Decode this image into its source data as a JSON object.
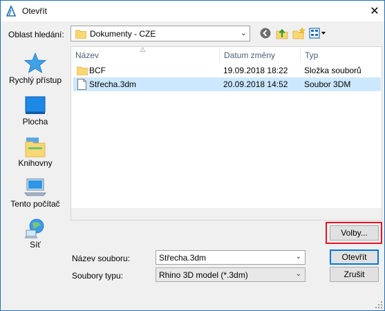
{
  "window": {
    "title": "Otevřít"
  },
  "lookin": {
    "label": "Oblast hledání:",
    "value": "Dokumenty - CZE"
  },
  "toolbar": {
    "icons": [
      "back-icon",
      "up-folder-icon",
      "new-folder-icon",
      "view-menu-icon"
    ]
  },
  "places": [
    {
      "label": "Rychlý přístup",
      "icon": "quick-access-star-icon"
    },
    {
      "label": "Plocha",
      "icon": "desktop-icon"
    },
    {
      "label": "Knihovny",
      "icon": "libraries-icon"
    },
    {
      "label": "Tento počítač",
      "icon": "this-pc-icon"
    },
    {
      "label": "Síť",
      "icon": "network-icon"
    }
  ],
  "filelist": {
    "columns": [
      "Název",
      "Datum změny",
      "Typ"
    ],
    "rows": [
      {
        "name": "BCF",
        "date": "19.09.2018 18:22",
        "type": "Složka souborů",
        "icon": "folder-icon",
        "selected": false
      },
      {
        "name": "Střecha.3dm",
        "date": "20.09.2018 14:52",
        "type": "Soubor 3DM",
        "icon": "file-icon",
        "selected": true
      }
    ]
  },
  "form": {
    "filename_label": "Název souboru:",
    "filename_value": "Střecha.3dm",
    "filetype_label": "Soubory typu:",
    "filetype_value": "Rhino 3D model (*.3dm)"
  },
  "buttons": {
    "options": "Volby...",
    "open": "Otevřít",
    "cancel": "Zrušit"
  },
  "colors": {
    "accent": "#0078d7",
    "highlight": "#e81123",
    "selection": "#cce8ff"
  }
}
